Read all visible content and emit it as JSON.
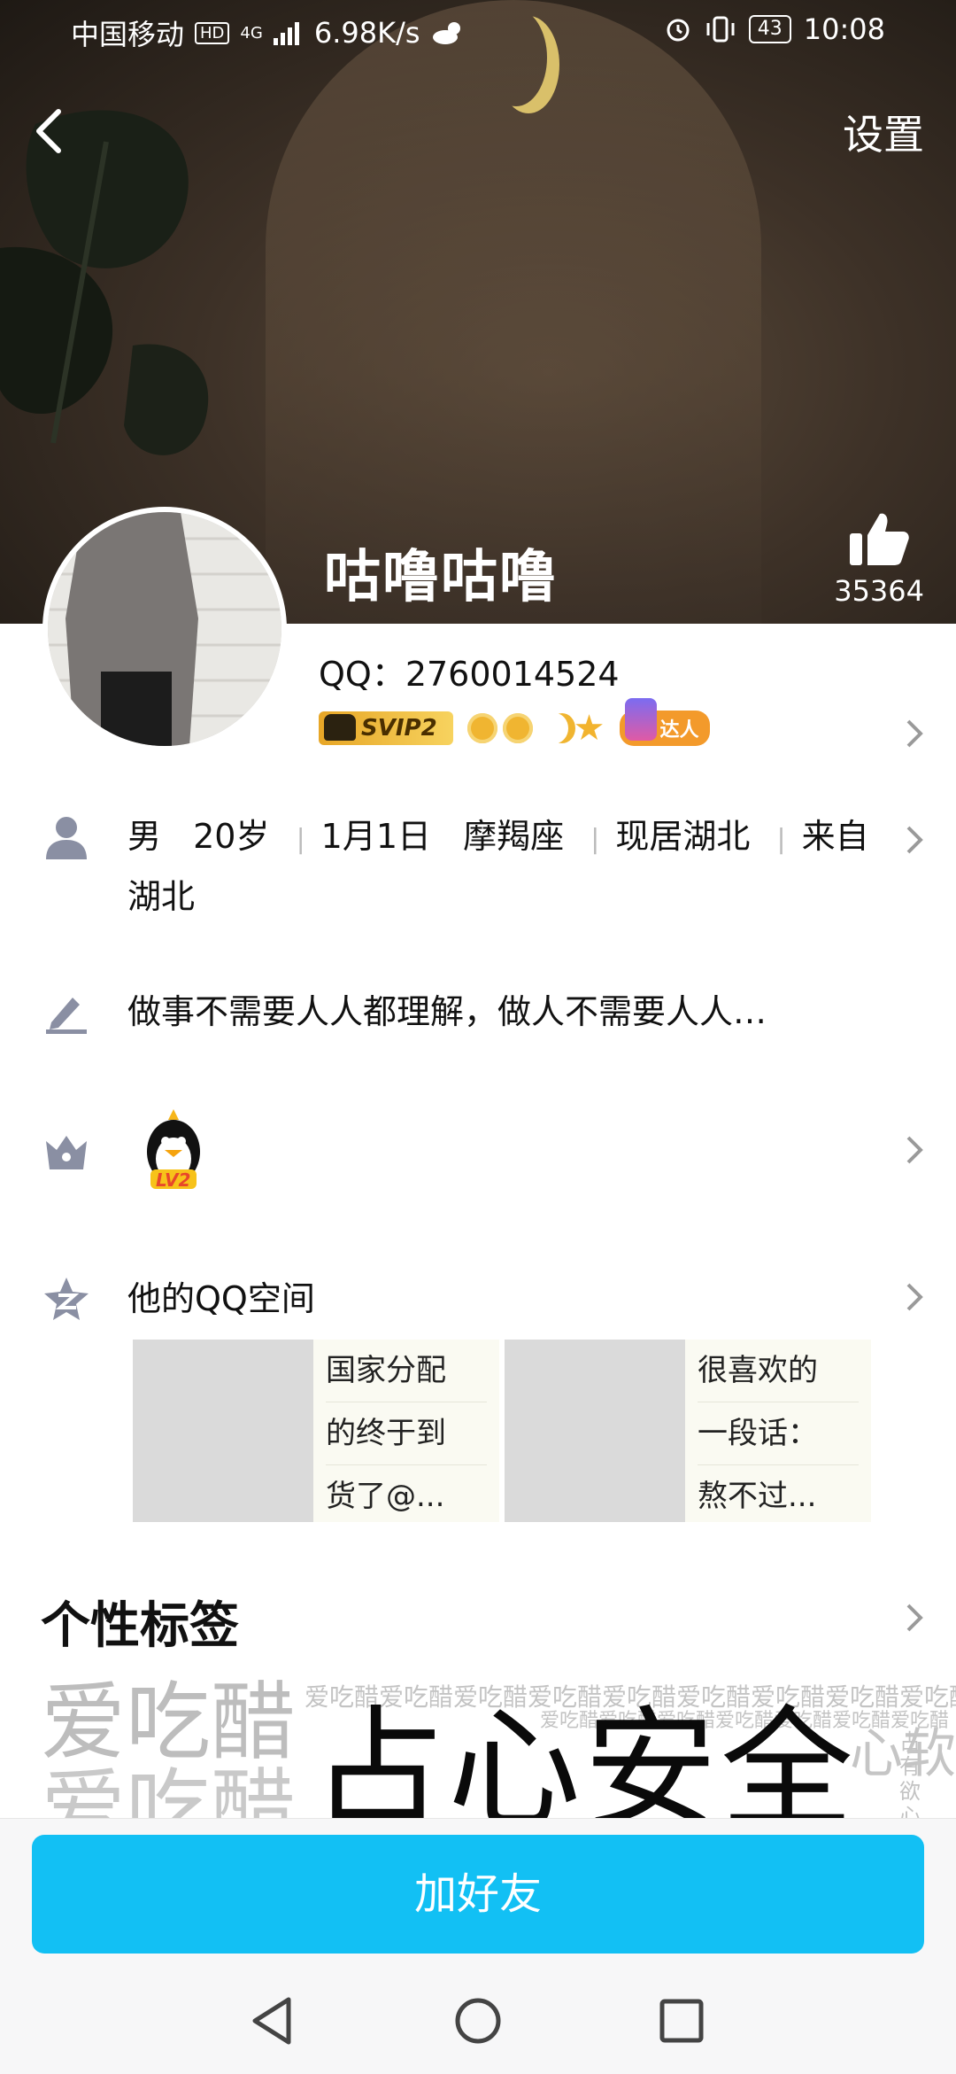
{
  "status_bar": {
    "carrier": "中国移动",
    "hd": "HD",
    "network": "4G",
    "speed": "6.98K/s",
    "battery": "43",
    "time": "10:08"
  },
  "header": {
    "settings_label": "设置",
    "nickname": "咕噜咕噜",
    "like_count": "35364"
  },
  "profile": {
    "qq_line": "QQ：2760014524",
    "svip_label": "SVIP2",
    "daren_label": "达人"
  },
  "info": {
    "gender": "男",
    "age": "20岁",
    "birthday": "1月1日",
    "zodiac": "摩羯座",
    "location": "现居湖北",
    "hometown_prefix": "来自",
    "hometown_rest": "湖北"
  },
  "signature": "做事不需要人人都理解，做人不需要人人…",
  "level_badge": "LV2",
  "qzone": {
    "title": "他的QQ空间",
    "items": [
      {
        "lines": [
          "国家分配",
          "的终于到",
          "货了@..."
        ]
      },
      {
        "lines": [
          "很喜欢的",
          "一段话：",
          "熬不过..."
        ]
      }
    ]
  },
  "tags": {
    "title": "个性标签",
    "big_grey": "爱吃醋",
    "main": "占心安全感",
    "side": "心软",
    "vertical": "占有欲心",
    "small_row1": "爱吃醋爱吃醋爱吃醋爱吃醋爱吃醋爱吃醋爱吃醋爱吃醋爱吃醋",
    "small_row2": "爱吃醋爱吃醋爱吃醋爱吃醋爱吃醋爱吃醋爱吃醋"
  },
  "actions": {
    "add_friend": "加好友"
  }
}
